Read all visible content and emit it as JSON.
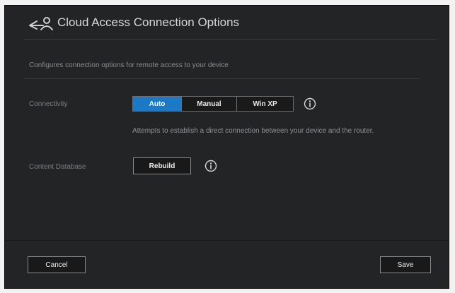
{
  "dialog": {
    "title": "Cloud Access Connection Options",
    "title_icon": "cloud-access-icon",
    "description": "Configures connection options for remote access to your device"
  },
  "connectivity": {
    "label": "Connectivity",
    "options": [
      {
        "label": "Auto",
        "selected": true
      },
      {
        "label": "Manual",
        "selected": false
      },
      {
        "label": "Win XP",
        "selected": false
      }
    ],
    "helper": "Attempts to establish a direct connection between your device and the router.",
    "info_icon": "info-icon"
  },
  "content_database": {
    "label": "Content Database",
    "button_label": "Rebuild",
    "info_icon": "info-icon"
  },
  "footer": {
    "cancel_label": "Cancel",
    "save_label": "Save"
  },
  "colors": {
    "dialog_bg": "#232426",
    "accent": "#1b79c5",
    "page_bg": "#f2f2f2"
  }
}
